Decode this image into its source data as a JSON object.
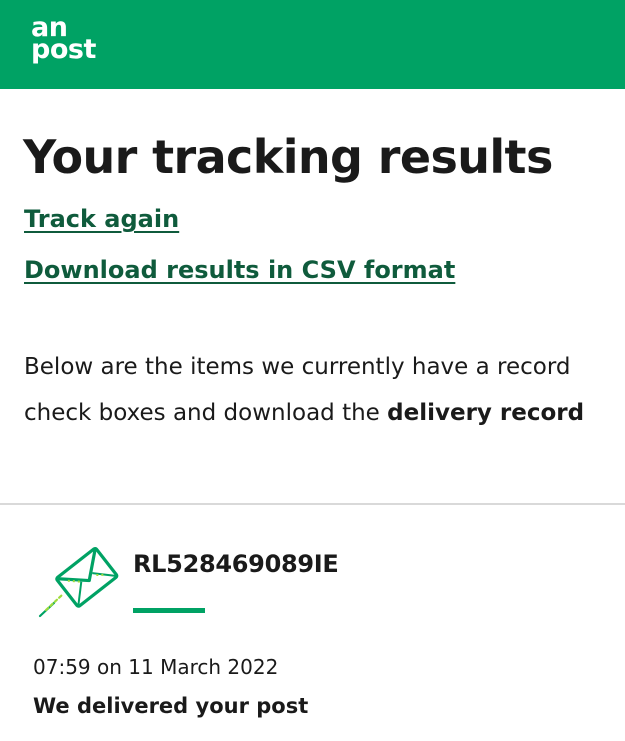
{
  "header": {
    "logo_line1": "an",
    "logo_line2": "post",
    "brand_color": "#00a264"
  },
  "page": {
    "title": "Your tracking results",
    "links": {
      "track_again": "Track again",
      "download_csv": "Download results in CSV format"
    },
    "intro_line1": "Below are the items we currently have a record",
    "intro_line2_prefix": "check boxes and download the ",
    "intro_line2_bold": "delivery record"
  },
  "item": {
    "icon": "envelope-icon",
    "tracking_number": "RL528469089IE",
    "event_time": "07:59 on 11 March 2022",
    "event_status": "We delivered your post"
  }
}
